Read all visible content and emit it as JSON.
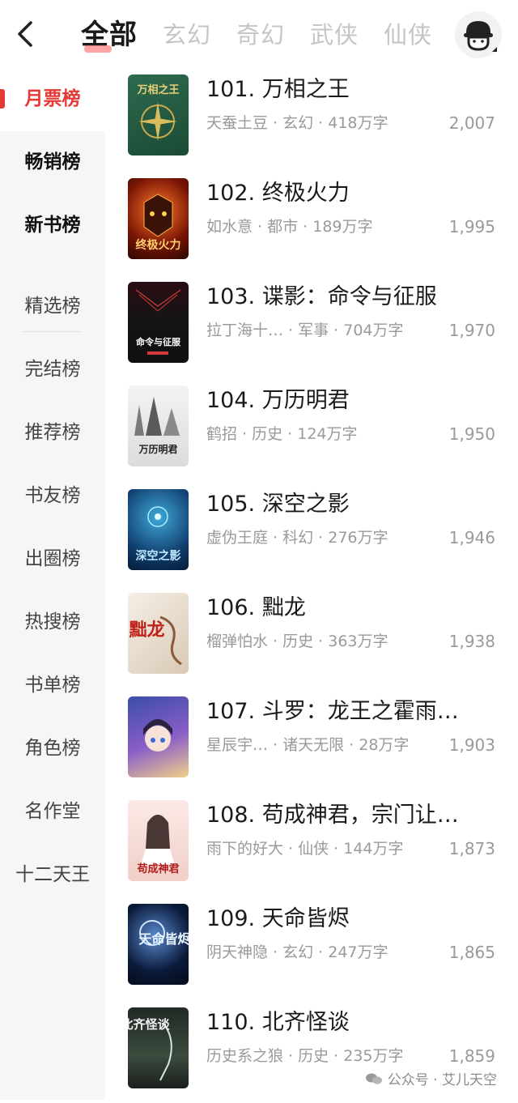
{
  "header": {
    "tabs": [
      {
        "label": "全部",
        "active": true
      },
      {
        "label": "玄幻"
      },
      {
        "label": "奇幻"
      },
      {
        "label": "武侠"
      },
      {
        "label": "仙侠"
      }
    ],
    "icons": {
      "back": "back-arrow-icon",
      "avatar": "user-avatar-icon"
    }
  },
  "sidebar": {
    "items": [
      {
        "label": "月票榜",
        "selected": true
      },
      {
        "label": "畅销榜"
      },
      {
        "label": "新书榜"
      },
      {
        "label": "精选榜"
      },
      {
        "label": "完结榜"
      },
      {
        "label": "推荐榜"
      },
      {
        "label": "书友榜"
      },
      {
        "label": "出圈榜"
      },
      {
        "label": "热搜榜"
      },
      {
        "label": "书单榜"
      },
      {
        "label": "角色榜"
      },
      {
        "label": "名作堂"
      },
      {
        "label": "十二天王"
      }
    ]
  },
  "books": [
    {
      "title": "101. 万相之王",
      "meta": "天蚕土豆 · 玄幻 · 418万字",
      "votes": "2,007",
      "cover_text": "万相之王"
    },
    {
      "title": "102. 终极火力",
      "meta": "如水意 · 都市 · 189万字",
      "votes": "1,995",
      "cover_text": "终极火力"
    },
    {
      "title": "103. 谍影：命令与征服",
      "meta": "拉丁海十…  · 军事 · 704万字",
      "votes": "1,970",
      "cover_text": "命令与征服"
    },
    {
      "title": "104. 万历明君",
      "meta": "鹤招 · 历史 · 124万字",
      "votes": "1,950",
      "cover_text": "万历明君"
    },
    {
      "title": "105. 深空之影",
      "meta": "虚伪王庭 · 科幻 · 276万字",
      "votes": "1,946",
      "cover_text": "深空之影"
    },
    {
      "title": "106. 黜龙",
      "meta": "榴弹怕水 · 历史 · 363万字",
      "votes": "1,938",
      "cover_text": "黜龙"
    },
    {
      "title": "107. 斗罗：龙王之霍雨…",
      "meta": "星辰宇…  · 诸天无限 · 28万字",
      "votes": "1,903",
      "cover_text": ""
    },
    {
      "title": "108. 苟成神君，宗门让…",
      "meta": "雨下的好大 · 仙侠 · 144万字",
      "votes": "1,873",
      "cover_text": "苟成神君"
    },
    {
      "title": "109. 天命皆烬",
      "meta": "阴天神隐 · 玄幻 · 247万字",
      "votes": "1,865",
      "cover_text": "天命皆烬"
    },
    {
      "title": "110. 北齐怪谈",
      "meta": "历史系之狼 · 历史 · 235万字",
      "votes": "1,859",
      "cover_text": "北齐怪谈"
    }
  ],
  "watermark": {
    "text": "公众号 · 艾儿天空",
    "icon": "wechat-icon"
  },
  "colors": {
    "accent": "#e53935",
    "muted": "#9a9a9a"
  }
}
